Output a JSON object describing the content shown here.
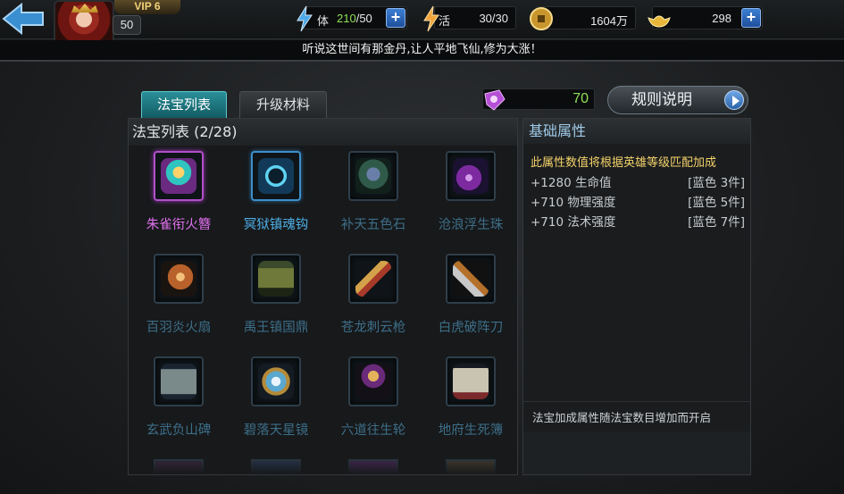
{
  "header": {
    "vip_label": "VIP 6",
    "level": "50",
    "stamina": {
      "label": "体",
      "current": "210",
      "max": "/50"
    },
    "vitality": {
      "label": "活",
      "value": "30/30"
    },
    "gold": "1604万",
    "ingot": "298",
    "plus": "+"
  },
  "ticker": {
    "message": "听说这世间有那金丹,让人平地飞仙,修为大涨！"
  },
  "tabs": [
    {
      "label": "法宝列表",
      "active": true
    },
    {
      "label": "升级材料",
      "active": false
    }
  ],
  "orb": {
    "value": "70"
  },
  "rules_button": {
    "label": "规则说明"
  },
  "treasure_list": {
    "title": "法宝列表 (2/28)",
    "items": [
      {
        "name": "朱雀衔火簪",
        "state": "owned-purple"
      },
      {
        "name": "冥狱镇魂钩",
        "state": "owned-blue"
      },
      {
        "name": "补天五色石",
        "state": "locked"
      },
      {
        "name": "沧浪浮生珠",
        "state": "locked"
      },
      {
        "name": "百羽炎火扇",
        "state": "locked"
      },
      {
        "name": "禹王镇国鼎",
        "state": "locked"
      },
      {
        "name": "苍龙刺云枪",
        "state": "locked"
      },
      {
        "name": "白虎破阵刀",
        "state": "locked"
      },
      {
        "name": "玄武负山碑",
        "state": "locked"
      },
      {
        "name": "碧落天星镜",
        "state": "locked"
      },
      {
        "name": "六道往生轮",
        "state": "locked"
      },
      {
        "name": "地府生死簿",
        "state": "locked"
      }
    ]
  },
  "attributes": {
    "title": "基础属性",
    "description": "此属性数值将根据英雄等级匹配加成",
    "rows": [
      {
        "stat": "+1280 生命值",
        "requirement": "[蓝色 3件]"
      },
      {
        "stat": "+710 物理强度",
        "requirement": "[蓝色 5件]"
      },
      {
        "stat": "+710 法术强度",
        "requirement": "[蓝色 7件]"
      }
    ],
    "footer": "法宝加成属性随法宝数目增加而开启"
  },
  "colors": {
    "accent_teal": "#1f7f88",
    "name_purple": "#e070ee",
    "name_blue": "#4fb0e8",
    "name_locked": "#3d6e88",
    "gold_text": "#f4d36a",
    "green_value": "#8fe25a"
  }
}
